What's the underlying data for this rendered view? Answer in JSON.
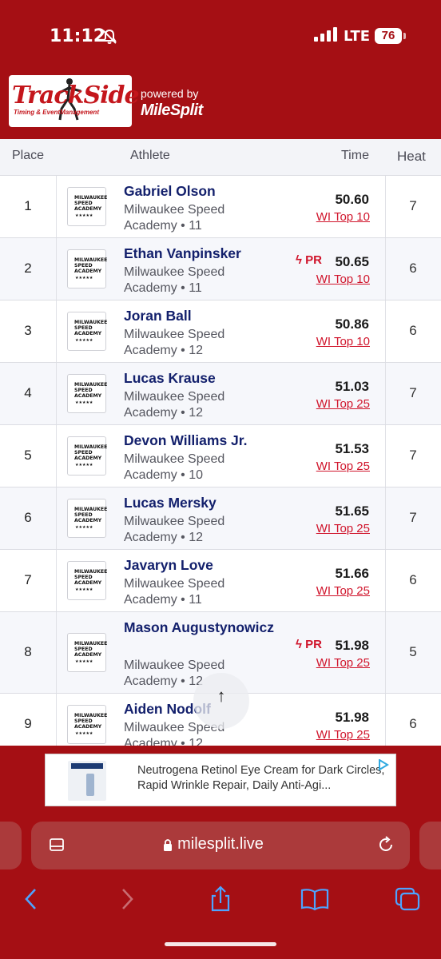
{
  "status": {
    "time": "11:12",
    "network": "LTE",
    "battery": "76"
  },
  "banner": {
    "logo_main": "TrackSide",
    "logo_sub": "Timing & EventManagement",
    "powered_by": "powered by",
    "brand": "MileSplit"
  },
  "table": {
    "headers": {
      "place": "Place",
      "athlete": "Athlete",
      "time": "Time",
      "heat": "Heat"
    },
    "team_logo_text": "MILWAUKEE SPEED ACADEMY",
    "rows": [
      {
        "place": "1",
        "name": "Gabriel Olson",
        "team": "Milwaukee Speed",
        "team2": "Academy • 11",
        "pr": "",
        "mark": "50.60",
        "rank": "WI Top 10",
        "heat": "7"
      },
      {
        "place": "2",
        "name": "Ethan Vanpinsker",
        "team": "Milwaukee Speed",
        "team2": "Academy • 11",
        "pr": "PR",
        "mark": "50.65",
        "rank": "WI Top 10",
        "heat": "6"
      },
      {
        "place": "3",
        "name": "Joran Ball",
        "team": "Milwaukee Speed",
        "team2": "Academy • 12",
        "pr": "",
        "mark": "50.86",
        "rank": "WI Top 10",
        "heat": "6"
      },
      {
        "place": "4",
        "name": "Lucas Krause",
        "team": "Milwaukee Speed",
        "team2": "Academy • 12",
        "pr": "",
        "mark": "51.03",
        "rank": "WI Top 25",
        "heat": "7"
      },
      {
        "place": "5",
        "name": "Devon Williams Jr.",
        "team": "Milwaukee Speed",
        "team2": "Academy • 10",
        "pr": "",
        "mark": "51.53",
        "rank": "WI Top 25",
        "heat": "7"
      },
      {
        "place": "6",
        "name": "Lucas Mersky",
        "team": "Milwaukee Speed",
        "team2": "Academy • 12",
        "pr": "",
        "mark": "51.65",
        "rank": "WI Top 25",
        "heat": "7"
      },
      {
        "place": "7",
        "name": "Javaryn Love",
        "team": "Milwaukee Speed",
        "team2": "Academy • 11",
        "pr": "",
        "mark": "51.66",
        "rank": "WI Top 25",
        "heat": "6"
      },
      {
        "place": "8",
        "name": "Mason Augustynowicz",
        "team": "Milwaukee Speed",
        "team2": "Academy • 12",
        "pr": "PR",
        "mark": "51.98",
        "rank": "WI Top 25",
        "heat": "5"
      },
      {
        "place": "9",
        "name": "Aiden Nodolf",
        "team": "Milwaukee Speed",
        "team2": "Academy • 12",
        "pr": "",
        "mark": "51.98",
        "rank": "WI Top 25",
        "heat": "6"
      }
    ]
  },
  "ad": {
    "text": "Neutrogena Retinol Eye Cream for Dark Circles, Rapid Wrinkle Repair, Daily Anti-Agi..."
  },
  "browser": {
    "url": "milesplit.live"
  },
  "colors": {
    "brand_red": "#a50f14",
    "link_red": "#d0142b",
    "name_navy": "#13206c"
  }
}
